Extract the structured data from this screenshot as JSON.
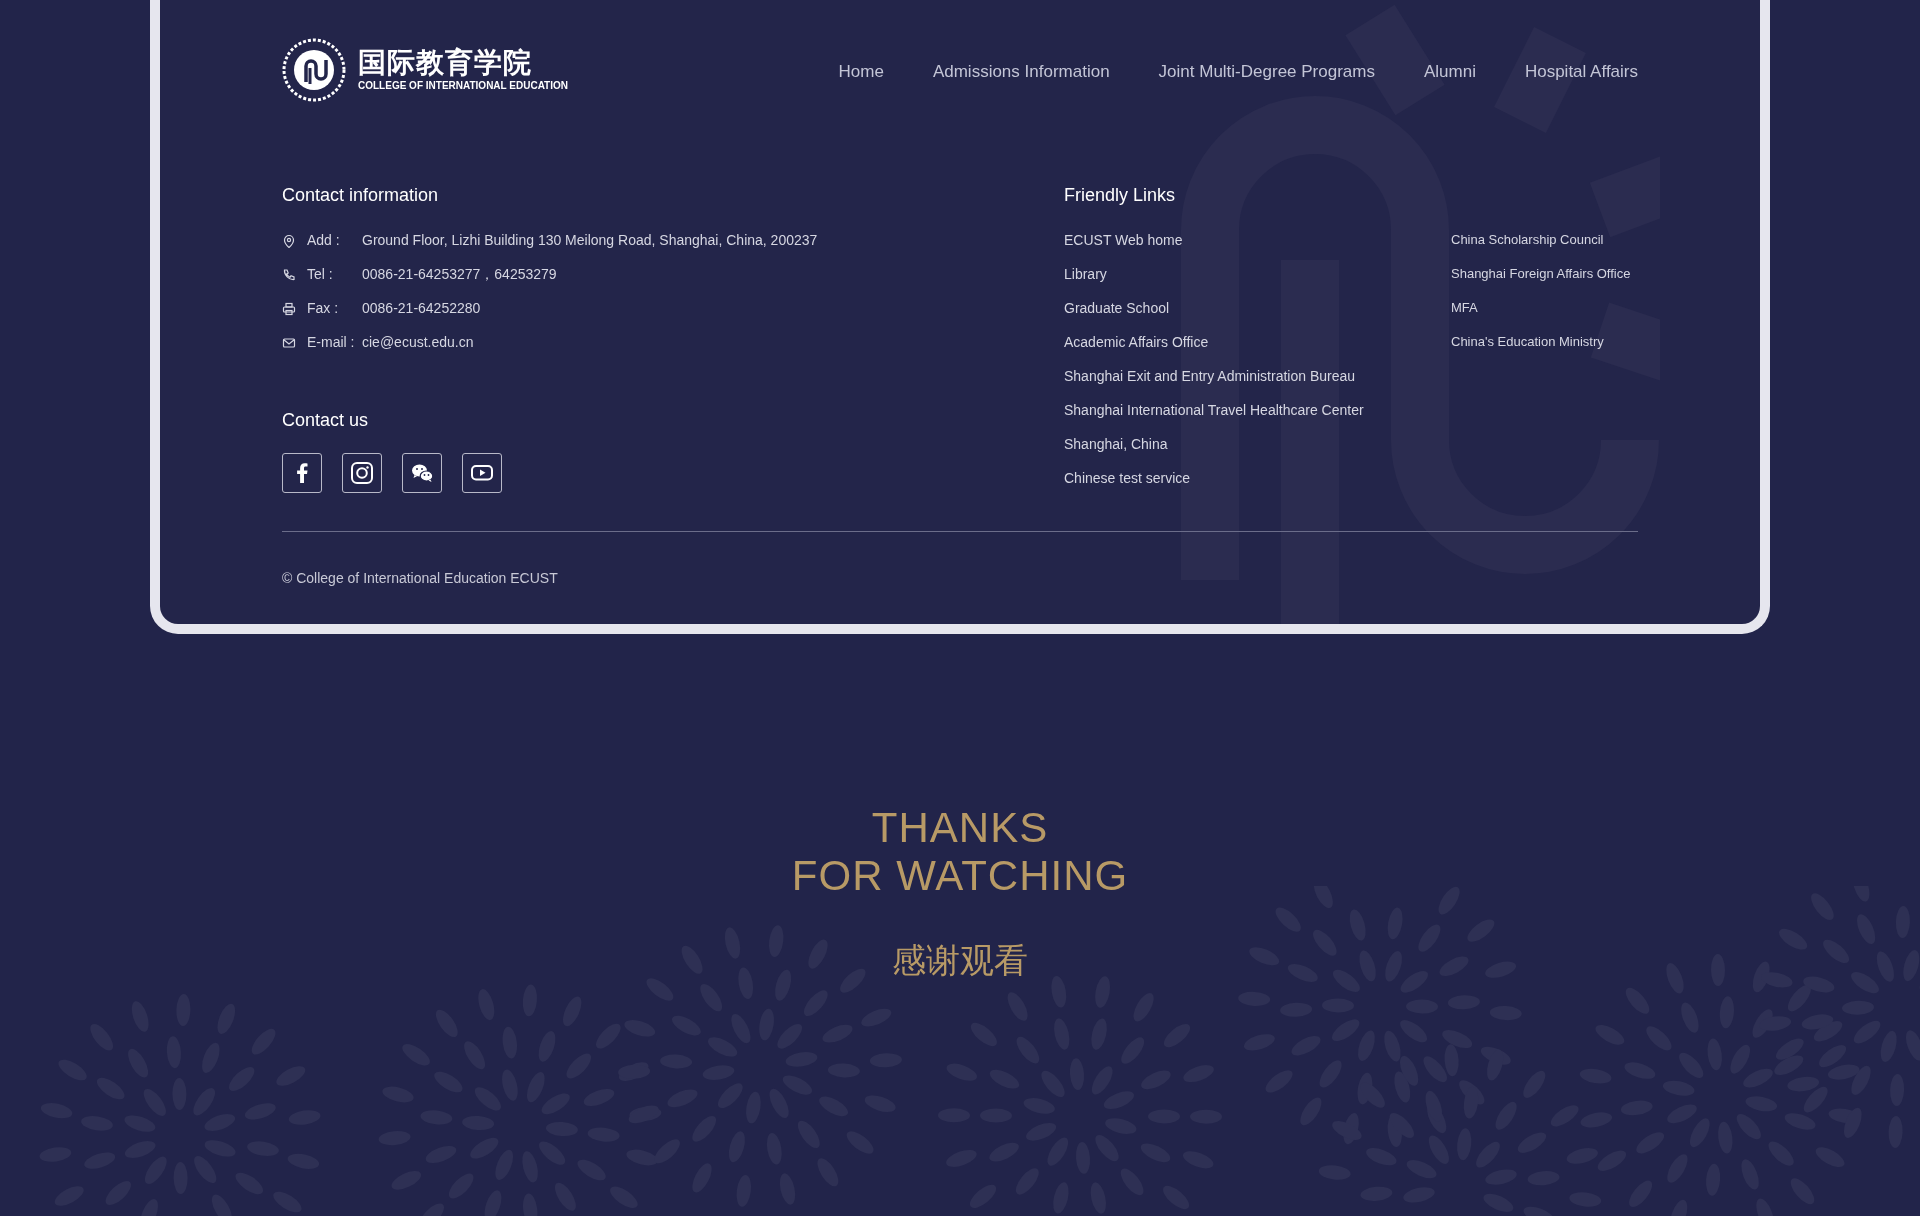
{
  "logo": {
    "title": "国际教育学院",
    "subtitle": "COLLEGE OF INTERNATIONAL EDUCATION"
  },
  "nav": [
    "Home",
    "Admissions Information",
    "Joint Multi-Degree Programs",
    "Alumni",
    "Hospital Affairs"
  ],
  "contact_information": {
    "heading": "Contact information",
    "rows": [
      {
        "kind": "address",
        "label": "Add :",
        "value": "Ground Floor, Lizhi Building 130 Meilong Road, Shanghai, China, 200237"
      },
      {
        "kind": "phone",
        "label": "Tel :",
        "value": "0086-21-64253277，64253279"
      },
      {
        "kind": "fax",
        "label": "Fax :",
        "value": "0086-21-64252280"
      },
      {
        "kind": "email",
        "label": "E-mail :",
        "value": "cie@ecust.edu.cn"
      }
    ]
  },
  "contact_us": {
    "heading": "Contact us",
    "social": [
      {
        "kind": "facebook"
      },
      {
        "kind": "instagram"
      },
      {
        "kind": "wechat"
      },
      {
        "kind": "youtube"
      }
    ]
  },
  "friendly_links": {
    "heading": "Friendly Links",
    "column_1": [
      "ECUST Web home",
      "Library",
      "Graduate School",
      "Academic Affairs Office",
      "Shanghai Exit and Entry Administration Bureau",
      "Shanghai International Travel Healthcare Center",
      "Shanghai, China",
      "Chinese test service"
    ],
    "column_2": [
      "China Scholarship Council",
      "Shanghai Foreign Affairs Office",
      "MFA",
      "China's Education Ministry"
    ]
  },
  "copyright": "© College of International Education ECUST",
  "closing": {
    "line_1": "THANKS",
    "line_2": "FOR WATCHING",
    "chinese": "感谢观看"
  }
}
